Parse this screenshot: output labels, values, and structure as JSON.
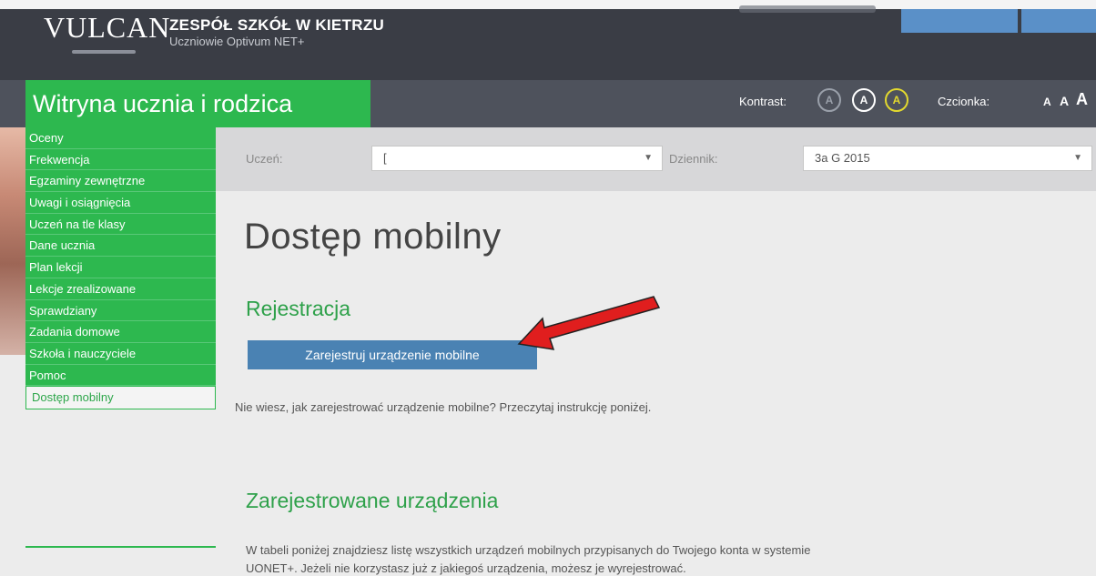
{
  "header": {
    "logo": "VULCAN",
    "school_name": "ZESPÓŁ SZKÓŁ W KIETRZU",
    "app_name": "Uczniowie Optivum NET+"
  },
  "nav": {
    "site_title": "Witryna ucznia i rodzica",
    "contrast_label": "Kontrast:",
    "contrast_options": [
      "A",
      "A",
      "A"
    ],
    "font_label": "Czcionka:",
    "font_sizes": [
      "A",
      "A",
      "A"
    ]
  },
  "sidebar": {
    "items": [
      {
        "label": "Oceny"
      },
      {
        "label": "Frekwencja"
      },
      {
        "label": "Egzaminy zewnętrzne"
      },
      {
        "label": "Uwagi i osiągnięcia"
      },
      {
        "label": "Uczeń na tle klasy"
      },
      {
        "label": "Dane ucznia"
      },
      {
        "label": "Plan lekcji"
      },
      {
        "label": "Lekcje zrealizowane"
      },
      {
        "label": "Sprawdziany"
      },
      {
        "label": "Zadania domowe"
      },
      {
        "label": "Szkoła i nauczyciele"
      },
      {
        "label": "Pomoc"
      },
      {
        "label": "Dostęp mobilny"
      }
    ]
  },
  "filters": {
    "student_label": "Uczeń:",
    "student_value": "[",
    "journal_label": "Dziennik:",
    "journal_value": "3a G 2015"
  },
  "main": {
    "title": "Dostęp mobilny",
    "section1_title": "Rejestracja",
    "register_button": "Zarejestruj urządzenie mobilne",
    "help_text": "Nie wiesz, jak zarejestrować urządzenie mobilne? Przeczytaj instrukcję poniżej.",
    "section2_title": "Zarejestrowane urządzenia",
    "devices_text_1": "W tabeli poniżej znajdziesz listę wszystkich urządzeń mobilnych przypisanych do Twojego konta w systemie",
    "devices_text_2": "UONET+. Jeżeli nie korzystasz już z jakiegoś urządzenia, możesz je wyrejestrować."
  },
  "colors": {
    "green": "#2db84f",
    "dark": "#3a3d45",
    "button_blue": "#4a82b3",
    "arrow_red": "#e01e1e"
  }
}
